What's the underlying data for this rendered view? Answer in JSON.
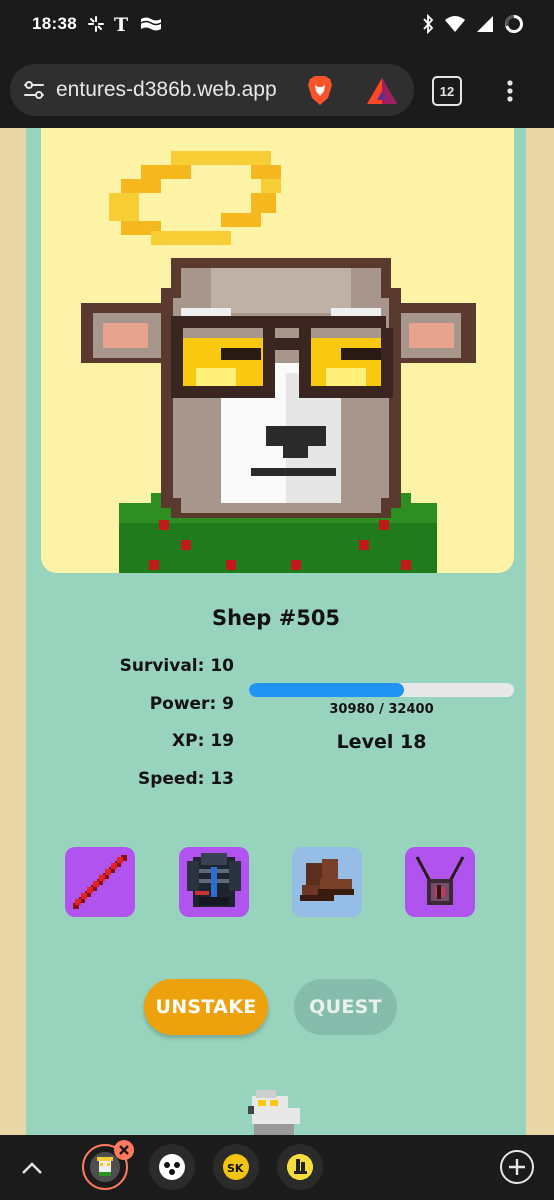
{
  "status_bar": {
    "time": "18:38"
  },
  "browser": {
    "url": "entures-d386b.web.app",
    "tab_count": "12"
  },
  "nft": {
    "name": "Shep #505",
    "stats": {
      "survival": "Survival: 10",
      "power": "Power: 9",
      "xp": "XP: 19",
      "speed": "Speed: 13"
    },
    "xp_progress": {
      "current": 30980,
      "max": 32400,
      "text": "30980 / 32400"
    },
    "level": "Level 18",
    "equipment": [
      {
        "name": "red-staff",
        "bg": "#b154ef"
      },
      {
        "name": "dark-armor",
        "bg": "#b154ef"
      },
      {
        "name": "leather-boots",
        "bg": "#95bde6"
      },
      {
        "name": "amulet",
        "bg": "#b154ef"
      }
    ]
  },
  "buttons": {
    "unstake": "UNSTAKE",
    "quest": "QUEST"
  },
  "colors": {
    "card": "#97d3bd",
    "portrait_bg": "#fdf3a6",
    "page_bg": "#e9d7a8",
    "xp_fill": "#2193f3",
    "unstake": "#eda10d",
    "quest": "#86bcac"
  }
}
